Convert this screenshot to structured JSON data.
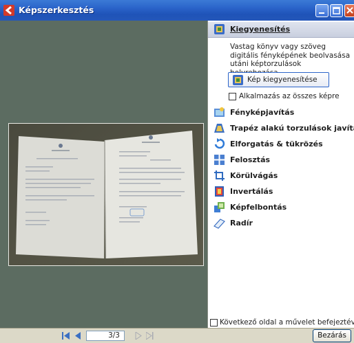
{
  "window": {
    "title": "Képszerkesztés"
  },
  "panel": {
    "active": {
      "label": "Kiegyenesítés",
      "description": "Vastag könyv vagy szöveg digitális fényképének beolvasása utáni képtorzulások helyrehozása.",
      "button_label": "Kép kiegyenesítése",
      "apply_all_label": "Alkalmazás az összes képre"
    },
    "items": [
      {
        "label": "Fényképjavítás",
        "icon": "photo-fix-icon"
      },
      {
        "label": "Trapéz alakú torzulások javítása",
        "icon": "trapezoid-icon"
      },
      {
        "label": "Elforgatás & tükrözés",
        "icon": "rotate-icon"
      },
      {
        "label": "Felosztás",
        "icon": "split-icon"
      },
      {
        "label": "Körülvágás",
        "icon": "crop-icon"
      },
      {
        "label": "Invertálás",
        "icon": "invert-icon"
      },
      {
        "label": "Képfelbontás",
        "icon": "resolution-icon"
      },
      {
        "label": "Radír",
        "icon": "eraser-icon"
      }
    ],
    "footer_checkbox_label": "Következő oldal a művelet befejeztével"
  },
  "bottom": {
    "page_indicator": "3/3",
    "close_label": "Bezárás"
  },
  "colors": {
    "titlebar": "#2a63c9",
    "preview_bg": "#5c6c61",
    "panel_bg": "#ffffff",
    "bottombar": "#dcd9c8"
  }
}
